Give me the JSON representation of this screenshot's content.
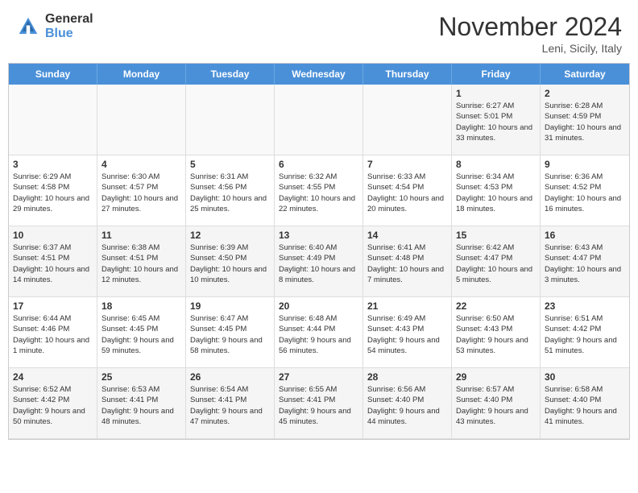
{
  "header": {
    "logo": {
      "general": "General",
      "blue": "Blue"
    },
    "title": "November 2024",
    "location": "Leni, Sicily, Italy"
  },
  "calendar": {
    "days_of_week": [
      "Sunday",
      "Monday",
      "Tuesday",
      "Wednesday",
      "Thursday",
      "Friday",
      "Saturday"
    ],
    "weeks": [
      [
        {
          "day": "",
          "empty": true
        },
        {
          "day": "",
          "empty": true
        },
        {
          "day": "",
          "empty": true
        },
        {
          "day": "",
          "empty": true
        },
        {
          "day": "",
          "empty": true
        },
        {
          "day": "1",
          "sunrise": "Sunrise: 6:27 AM",
          "sunset": "Sunset: 5:01 PM",
          "daylight": "Daylight: 10 hours and 33 minutes."
        },
        {
          "day": "2",
          "sunrise": "Sunrise: 6:28 AM",
          "sunset": "Sunset: 4:59 PM",
          "daylight": "Daylight: 10 hours and 31 minutes."
        }
      ],
      [
        {
          "day": "3",
          "sunrise": "Sunrise: 6:29 AM",
          "sunset": "Sunset: 4:58 PM",
          "daylight": "Daylight: 10 hours and 29 minutes."
        },
        {
          "day": "4",
          "sunrise": "Sunrise: 6:30 AM",
          "sunset": "Sunset: 4:57 PM",
          "daylight": "Daylight: 10 hours and 27 minutes."
        },
        {
          "day": "5",
          "sunrise": "Sunrise: 6:31 AM",
          "sunset": "Sunset: 4:56 PM",
          "daylight": "Daylight: 10 hours and 25 minutes."
        },
        {
          "day": "6",
          "sunrise": "Sunrise: 6:32 AM",
          "sunset": "Sunset: 4:55 PM",
          "daylight": "Daylight: 10 hours and 22 minutes."
        },
        {
          "day": "7",
          "sunrise": "Sunrise: 6:33 AM",
          "sunset": "Sunset: 4:54 PM",
          "daylight": "Daylight: 10 hours and 20 minutes."
        },
        {
          "day": "8",
          "sunrise": "Sunrise: 6:34 AM",
          "sunset": "Sunset: 4:53 PM",
          "daylight": "Daylight: 10 hours and 18 minutes."
        },
        {
          "day": "9",
          "sunrise": "Sunrise: 6:36 AM",
          "sunset": "Sunset: 4:52 PM",
          "daylight": "Daylight: 10 hours and 16 minutes."
        }
      ],
      [
        {
          "day": "10",
          "sunrise": "Sunrise: 6:37 AM",
          "sunset": "Sunset: 4:51 PM",
          "daylight": "Daylight: 10 hours and 14 minutes."
        },
        {
          "day": "11",
          "sunrise": "Sunrise: 6:38 AM",
          "sunset": "Sunset: 4:51 PM",
          "daylight": "Daylight: 10 hours and 12 minutes."
        },
        {
          "day": "12",
          "sunrise": "Sunrise: 6:39 AM",
          "sunset": "Sunset: 4:50 PM",
          "daylight": "Daylight: 10 hours and 10 minutes."
        },
        {
          "day": "13",
          "sunrise": "Sunrise: 6:40 AM",
          "sunset": "Sunset: 4:49 PM",
          "daylight": "Daylight: 10 hours and 8 minutes."
        },
        {
          "day": "14",
          "sunrise": "Sunrise: 6:41 AM",
          "sunset": "Sunset: 4:48 PM",
          "daylight": "Daylight: 10 hours and 7 minutes."
        },
        {
          "day": "15",
          "sunrise": "Sunrise: 6:42 AM",
          "sunset": "Sunset: 4:47 PM",
          "daylight": "Daylight: 10 hours and 5 minutes."
        },
        {
          "day": "16",
          "sunrise": "Sunrise: 6:43 AM",
          "sunset": "Sunset: 4:47 PM",
          "daylight": "Daylight: 10 hours and 3 minutes."
        }
      ],
      [
        {
          "day": "17",
          "sunrise": "Sunrise: 6:44 AM",
          "sunset": "Sunset: 4:46 PM",
          "daylight": "Daylight: 10 hours and 1 minute."
        },
        {
          "day": "18",
          "sunrise": "Sunrise: 6:45 AM",
          "sunset": "Sunset: 4:45 PM",
          "daylight": "Daylight: 9 hours and 59 minutes."
        },
        {
          "day": "19",
          "sunrise": "Sunrise: 6:47 AM",
          "sunset": "Sunset: 4:45 PM",
          "daylight": "Daylight: 9 hours and 58 minutes."
        },
        {
          "day": "20",
          "sunrise": "Sunrise: 6:48 AM",
          "sunset": "Sunset: 4:44 PM",
          "daylight": "Daylight: 9 hours and 56 minutes."
        },
        {
          "day": "21",
          "sunrise": "Sunrise: 6:49 AM",
          "sunset": "Sunset: 4:43 PM",
          "daylight": "Daylight: 9 hours and 54 minutes."
        },
        {
          "day": "22",
          "sunrise": "Sunrise: 6:50 AM",
          "sunset": "Sunset: 4:43 PM",
          "daylight": "Daylight: 9 hours and 53 minutes."
        },
        {
          "day": "23",
          "sunrise": "Sunrise: 6:51 AM",
          "sunset": "Sunset: 4:42 PM",
          "daylight": "Daylight: 9 hours and 51 minutes."
        }
      ],
      [
        {
          "day": "24",
          "sunrise": "Sunrise: 6:52 AM",
          "sunset": "Sunset: 4:42 PM",
          "daylight": "Daylight: 9 hours and 50 minutes."
        },
        {
          "day": "25",
          "sunrise": "Sunrise: 6:53 AM",
          "sunset": "Sunset: 4:41 PM",
          "daylight": "Daylight: 9 hours and 48 minutes."
        },
        {
          "day": "26",
          "sunrise": "Sunrise: 6:54 AM",
          "sunset": "Sunset: 4:41 PM",
          "daylight": "Daylight: 9 hours and 47 minutes."
        },
        {
          "day": "27",
          "sunrise": "Sunrise: 6:55 AM",
          "sunset": "Sunset: 4:41 PM",
          "daylight": "Daylight: 9 hours and 45 minutes."
        },
        {
          "day": "28",
          "sunrise": "Sunrise: 6:56 AM",
          "sunset": "Sunset: 4:40 PM",
          "daylight": "Daylight: 9 hours and 44 minutes."
        },
        {
          "day": "29",
          "sunrise": "Sunrise: 6:57 AM",
          "sunset": "Sunset: 4:40 PM",
          "daylight": "Daylight: 9 hours and 43 minutes."
        },
        {
          "day": "30",
          "sunrise": "Sunrise: 6:58 AM",
          "sunset": "Sunset: 4:40 PM",
          "daylight": "Daylight: 9 hours and 41 minutes."
        }
      ]
    ]
  }
}
